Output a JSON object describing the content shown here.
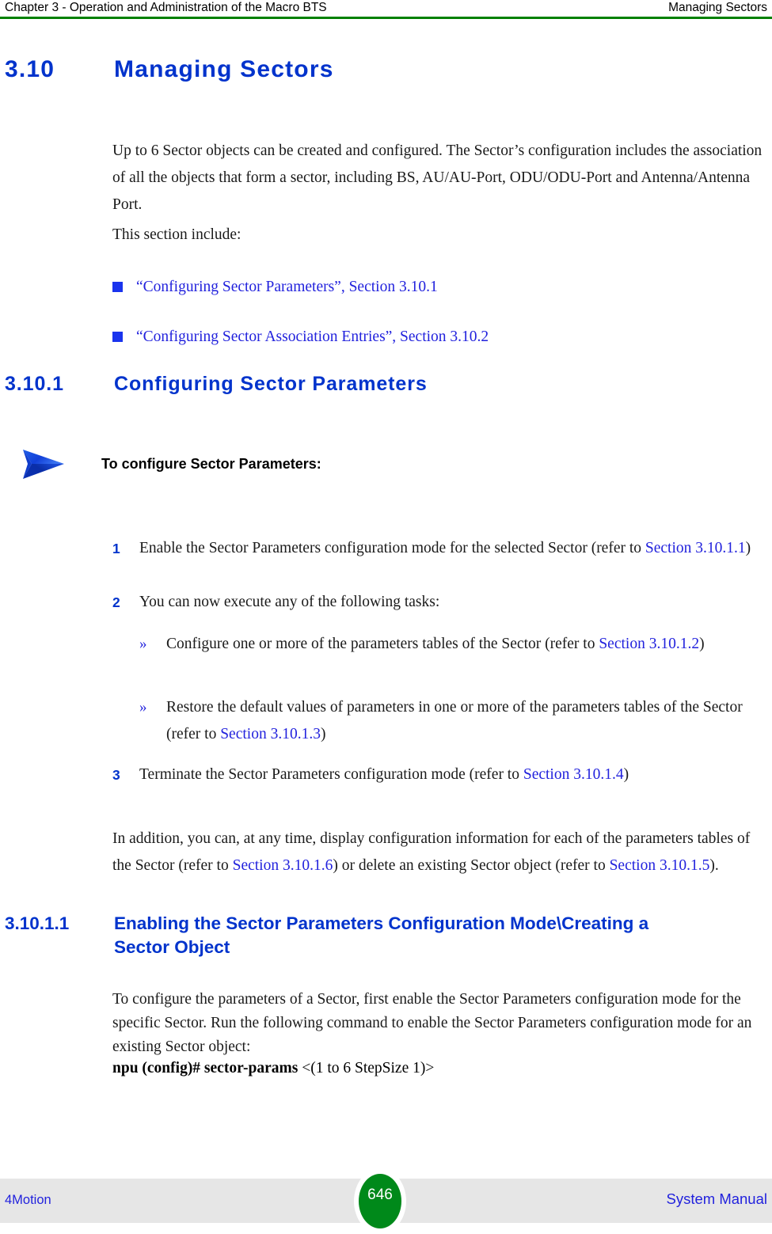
{
  "header": {
    "left": "Chapter 3 - Operation and Administration of the Macro BTS",
    "right": "Managing Sectors",
    "rule_color": "#008000"
  },
  "headings": {
    "h1_number": "3.10",
    "h1_title": "Managing Sectors",
    "h2_number": "3.10.1",
    "h2_title": "Configuring Sector Parameters",
    "h3_number": "3.10.1.1",
    "h3_title": "Enabling the Sector Parameters Configuration Mode\\Creating a Sector Object",
    "heading_color": "#0033cc"
  },
  "intro": {
    "paragraph_1": "Up to 6 Sector objects can be created and configured. The Sector’s configuration includes the association of all the objects that form a sector, including BS, AU/AU-Port, ODU/ODU-Port and Antenna/Antenna Port.",
    "paragraph_2": "This section include:"
  },
  "section_links": [
    {
      "bullet": "square",
      "text": "“Configuring Sector Parameters”, Section 3.10.1"
    },
    {
      "bullet": "square",
      "text": "“Configuring Sector Association Entries”, Section 3.10.2"
    }
  ],
  "procedure": {
    "icon": "blue-arrow-icon",
    "title": "To configure Sector Parameters:",
    "steps": [
      {
        "number": "1",
        "text_before": "Enable the Sector Parameters configuration mode for the selected Sector (refer to ",
        "link": "Section 3.10.1.1",
        "text_after": ")"
      },
      {
        "number": "2",
        "text_before": "You can now execute any of the following tasks:",
        "link": "",
        "text_after": ""
      },
      {
        "number": "3",
        "text_before": "Terminate the Sector Parameters configuration mode (refer to ",
        "link": "Section 3.10.1.4",
        "text_after": ")"
      }
    ],
    "substeps": [
      {
        "marker": "»",
        "text_before": "Configure one or more of the parameters tables of the Sector (refer to ",
        "link": "Section 3.10.1.2",
        "text_after": ")"
      },
      {
        "marker": "»",
        "text_before": "Restore the default values of parameters in one or more of the parameters tables of the Sector (refer to ",
        "link": "Section 3.10.1.3",
        "text_after": ")"
      }
    ]
  },
  "addendum": {
    "text_1": "In addition, you can, at any time, display configuration information for each of the parameters tables of the Sector (refer to ",
    "link_1": "Section 3.10.1.6",
    "text_2": ") or delete an existing Sector object (refer to ",
    "link_2": "Section 3.10.1.5",
    "text_3": ")."
  },
  "subsection": {
    "paragraph": "To configure the parameters of a Sector, first enable the Sector Parameters configuration mode for the specific Sector. Run the following command to enable the Sector Parameters configuration mode for an existing Sector object:",
    "command_bold": "npu (config)# sector-params",
    "command_arg": " <(1 to 6 StepSize 1)>"
  },
  "footer": {
    "left": "4Motion",
    "page_number": "646",
    "right": "System Manual",
    "band_color": "#e6e6e6",
    "page_badge_color": "#00891a",
    "link_color": "#2222dd"
  }
}
